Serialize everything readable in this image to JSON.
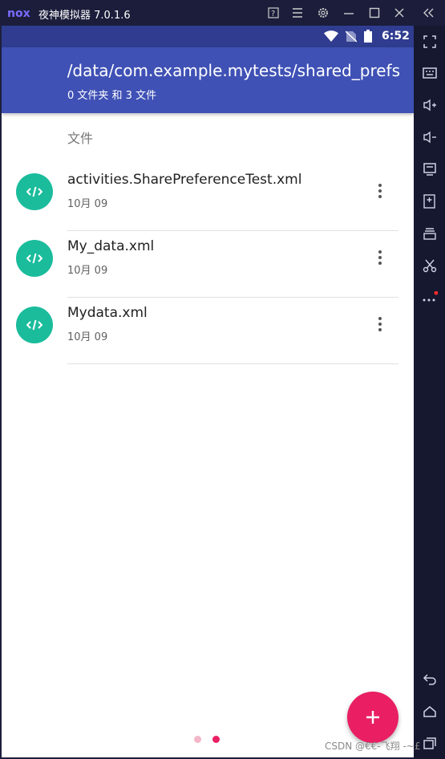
{
  "window": {
    "title": "夜神模拟器 7.0.1.6",
    "logo_text": "nox"
  },
  "statusbar": {
    "time": "6:52"
  },
  "appbar": {
    "path": "ata/data/com.example.mytests/shared_prefs",
    "subtitle": "0 文件夹 和 3 文件"
  },
  "section": {
    "header": "文件"
  },
  "files": [
    {
      "name": "activities.SharePreferenceTest.xml",
      "date": "10月 09"
    },
    {
      "name": "My_data.xml",
      "date": "10月 09"
    },
    {
      "name": "Mydata.xml",
      "date": "10月 09"
    }
  ],
  "watermark": "CSDN @€€-飞翔 -~£",
  "colors": {
    "appbar": "#3f51b5",
    "file_icon": "#1abc9c",
    "fab": "#e91e63"
  }
}
